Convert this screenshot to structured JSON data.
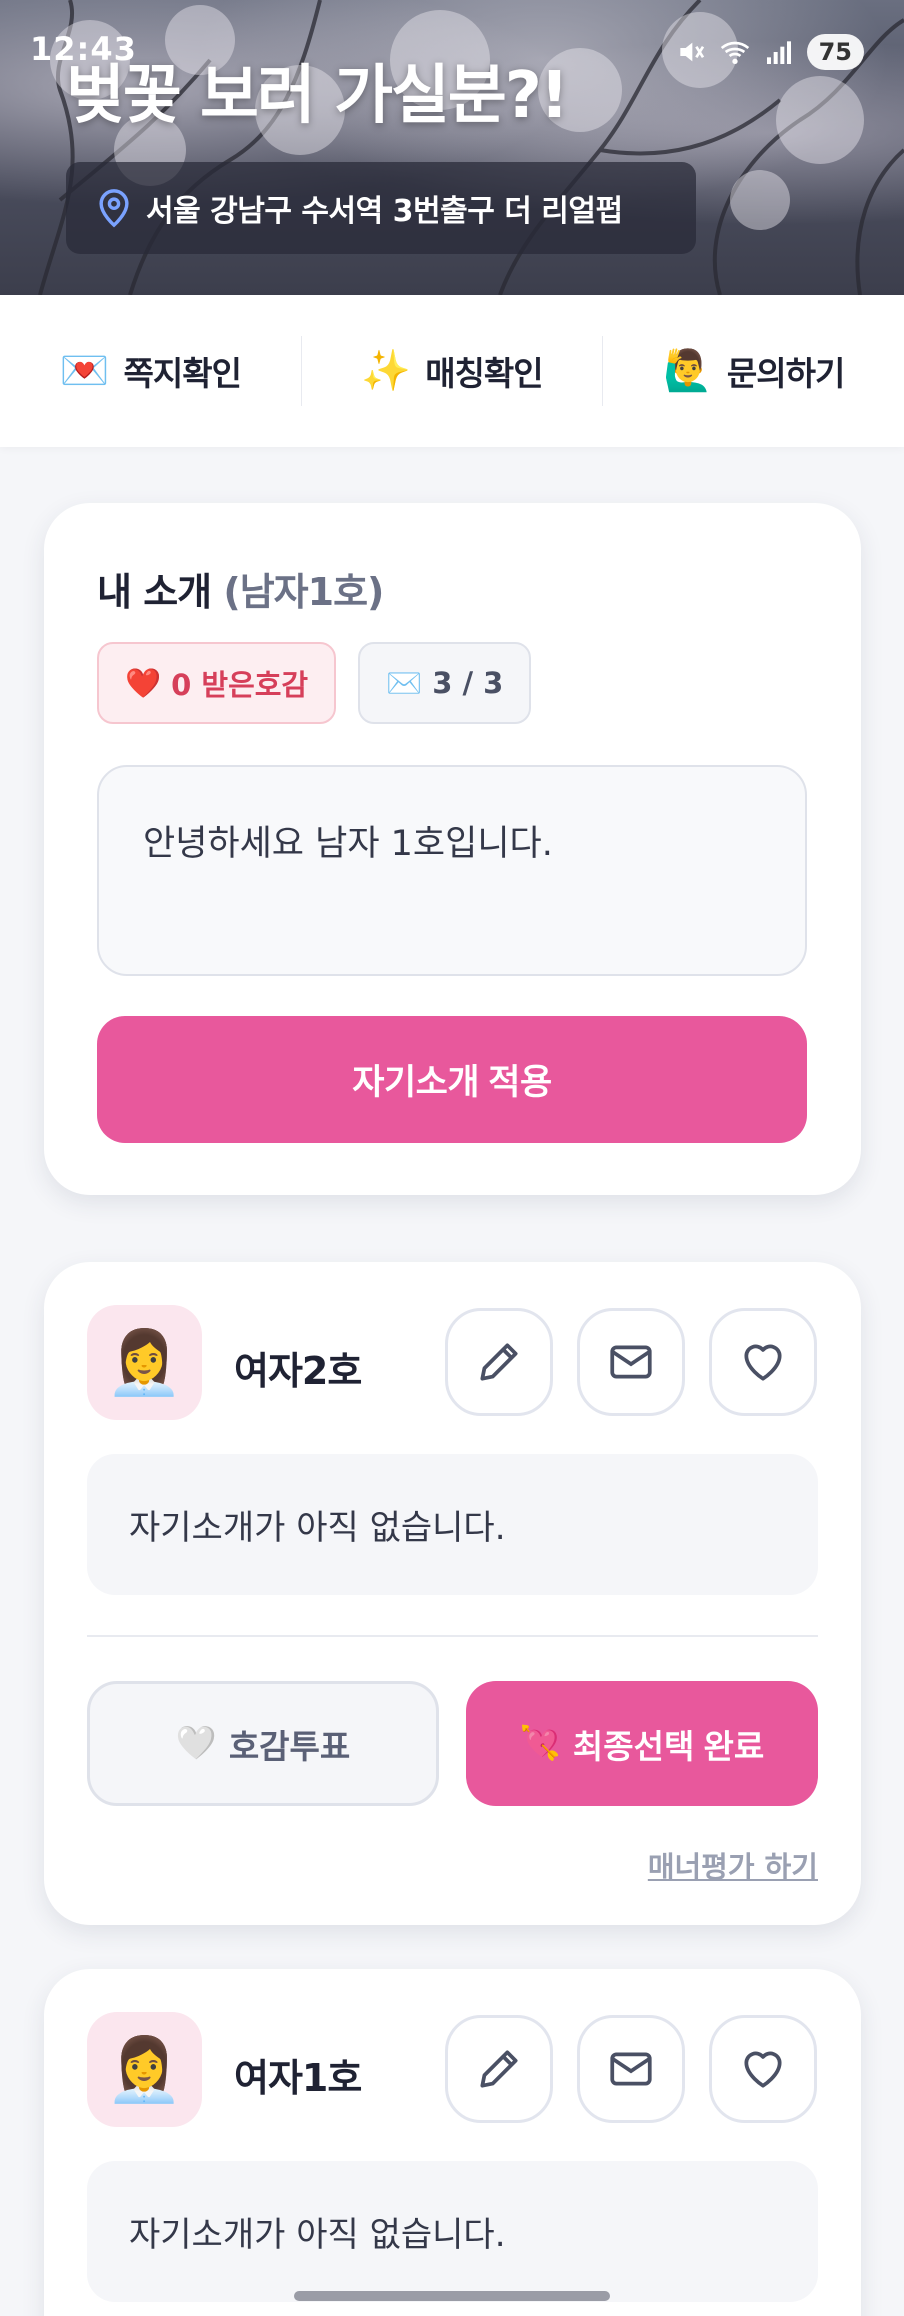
{
  "status_bar": {
    "time": "12:43",
    "battery": "75"
  },
  "hero": {
    "title": "벚꽃 보러 가실분?!",
    "location": "서울 강남구 수서역 3번출구 더 리얼펍"
  },
  "nav": {
    "items": [
      {
        "icon": "💌",
        "label": "쪽지확인"
      },
      {
        "icon": "✨",
        "label": "매칭확인"
      },
      {
        "icon": "🙋‍♂️",
        "label": "문의하기"
      }
    ]
  },
  "my_intro": {
    "title": "내 소개",
    "subtitle": "(남자1호)",
    "likes_icon": "❤️",
    "likes_label": "0 받은호감",
    "messages_icon": "✉️",
    "messages_label": "3 / 3",
    "intro_text": "안녕하세요 남자 1호입니다.",
    "apply_button": "자기소개 적용"
  },
  "profiles": [
    {
      "avatar": "👩‍💼",
      "name": "여자2호",
      "intro": "자기소개가 아직 없습니다.",
      "vote_icon": "🤍",
      "vote_label": "호감투표",
      "final_icon": "💘",
      "final_label": "최종선택 완료",
      "manner_link": "매너평가 하기"
    },
    {
      "avatar": "👩‍💼",
      "name": "여자1호",
      "intro": "자기소개가 아직 없습니다."
    }
  ],
  "colors": {
    "accent": "#e8589c",
    "like_text": "#d63f5a",
    "avatar_bg": "#fbe6ee"
  }
}
